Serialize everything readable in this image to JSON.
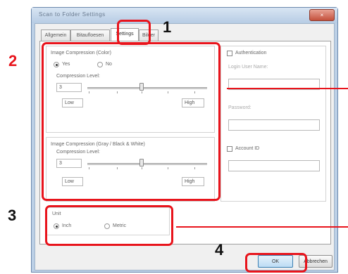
{
  "window": {
    "title": "Scan to Folder Settings",
    "close_label": "×"
  },
  "tabs": [
    {
      "label": "Allgemein"
    },
    {
      "label": "Bitaufloesen"
    },
    {
      "label": "Settings"
    },
    {
      "label": "Bilder"
    }
  ],
  "image_compression_color": {
    "title": "Image Compression (Color)",
    "options": [
      {
        "label": "Yes",
        "selected": true
      },
      {
        "label": "No",
        "selected": false
      }
    ],
    "compression_level_label": "Compression Level:",
    "value": "3",
    "low_label": "Low",
    "high_label": "High"
  },
  "image_compression_gray": {
    "title": "Image Compression (Gray / Black & White)",
    "compression_level_label": "Compression Level:",
    "value": "3",
    "low_label": "Low",
    "high_label": "High"
  },
  "authentication": {
    "label": "Authentication",
    "login_user_name_label": "Login User Name:",
    "password_label": "Password:"
  },
  "account_id": {
    "label": "Account ID"
  },
  "unit": {
    "title": "Unit",
    "options": [
      {
        "label": "Inch",
        "selected": true
      },
      {
        "label": "Metric",
        "selected": false
      }
    ]
  },
  "buttons": {
    "ok": "OK",
    "cancel": "Abbrechen"
  },
  "annotations": {
    "n1": "1",
    "n2": "2",
    "n3": "3",
    "n4": "4",
    "accent_color": "#e8141c"
  }
}
